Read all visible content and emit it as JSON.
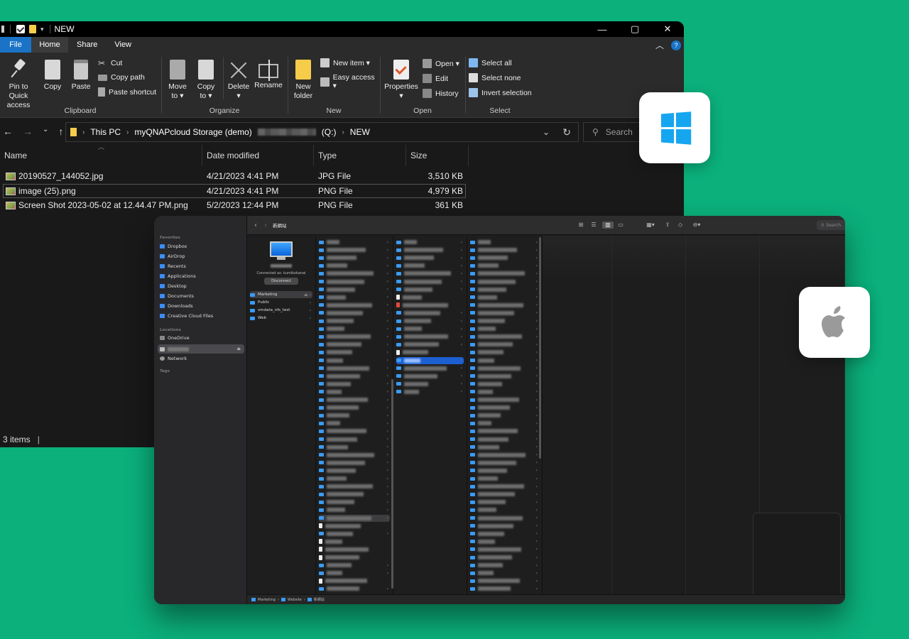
{
  "colors": {
    "background": "#0bb07b",
    "win_accent": "#1a73c7",
    "mac_selection": "#1c5fd0",
    "folder_blue": "#3b9bf5"
  },
  "windows_explorer": {
    "title": "NEW",
    "controls": {
      "minimize": "—",
      "maximize": "▢",
      "close": "✕"
    },
    "tabs": [
      "File",
      "Home",
      "Share",
      "View"
    ],
    "ribbon": {
      "clipboard": {
        "group_label": "Clipboard",
        "pin_label_1": "Pin to Quick",
        "pin_label_2": "access",
        "copy": "Copy",
        "paste": "Paste",
        "cut": "Cut",
        "copy_path": "Copy path",
        "paste_shortcut": "Paste shortcut"
      },
      "organize": {
        "group_label": "Organize",
        "move_1": "Move",
        "move_2": "to ▾",
        "copy_1": "Copy",
        "copy_2": "to ▾",
        "delete": "Delete",
        "delete_arrow": "▾",
        "rename": "Rename"
      },
      "new": {
        "group_label": "New",
        "new_folder_1": "New",
        "new_folder_2": "folder",
        "new_item": "New item ▾",
        "easy_access": "Easy access ▾"
      },
      "open": {
        "group_label": "Open",
        "properties": "Properties",
        "properties_arrow": "▾",
        "open": "Open ▾",
        "edit": "Edit",
        "history": "History"
      },
      "select": {
        "group_label": "Select",
        "select_all": "Select all",
        "select_none": "Select none",
        "invert": "Invert selection"
      }
    },
    "address": {
      "crumbs": [
        "This PC",
        "myQNAPcloud Storage (demo)",
        "(Q:)",
        "NEW"
      ],
      "search_placeholder": "Search"
    },
    "columns": [
      "Name",
      "Date modified",
      "Type",
      "Size"
    ],
    "files": [
      {
        "name": "20190527_144052.jpg",
        "date": "4/21/2023 4:41 PM",
        "type": "JPG File",
        "size": "3,510 KB"
      },
      {
        "name": "image (25).png",
        "date": "4/21/2023 4:41 PM",
        "type": "PNG File",
        "size": "4,979 KB"
      },
      {
        "name": "Screen Shot 2023-05-02 at 12.44.47 PM.png",
        "date": "5/2/2023 12:44 PM",
        "type": "PNG File",
        "size": "361 KB"
      }
    ],
    "status": "3 items"
  },
  "mac_finder": {
    "toolbar_title": "新網站",
    "search_placeholder": "Search",
    "sidebar": {
      "favorites_header": "Favorites",
      "favorites": [
        "Dropbox",
        "AirDrop",
        "Recents",
        "Applications",
        "Desktop",
        "Documents",
        "Downloads",
        "Creative Cloud Files"
      ],
      "locations_header": "Locations",
      "locations": [
        "OneDrive",
        "Network"
      ],
      "tags_header": "Tags"
    },
    "server": {
      "connected_as": "Connected as: kumikokanai",
      "disconnect": "Disconnect"
    },
    "shares": [
      "Marketing",
      "Public",
      "vmdata_nfs_test",
      "Web"
    ],
    "pathbar": [
      "Marketing",
      "Website",
      "新網站"
    ]
  }
}
